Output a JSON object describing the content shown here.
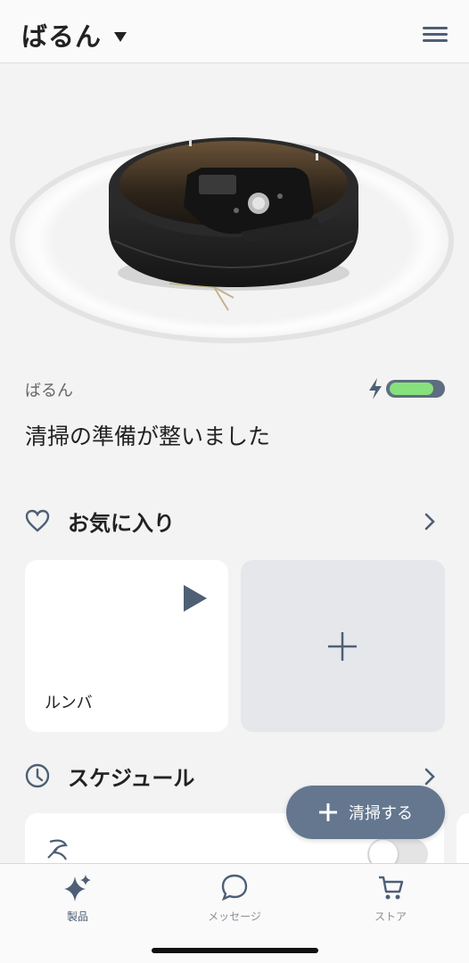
{
  "header": {
    "title": "ばるん",
    "dropdown_icon": "caret-down-icon",
    "menu_icon": "hamburger-menu-icon"
  },
  "device": {
    "name": "ばるん",
    "status": "清掃の準備が整いました",
    "charging_icon": "lightning-bolt-icon",
    "battery_level": 0.85,
    "battery_color": "#86e07c"
  },
  "favorites": {
    "label": "お気に入り",
    "icon": "heart-icon",
    "items": [
      {
        "name": "ルンバ",
        "action_icon": "play-icon"
      }
    ],
    "add_icon": "plus-icon"
  },
  "schedule": {
    "label": "スケジュール",
    "icon": "clock-icon",
    "toggle_on": false
  },
  "fab": {
    "label": "清掃する",
    "icon": "plus-icon"
  },
  "tabs": [
    {
      "label": "製品",
      "icon": "sparkle-icon",
      "active": true
    },
    {
      "label": "メッセージ",
      "icon": "chat-bubble-icon",
      "active": false
    },
    {
      "label": "ストア",
      "icon": "cart-icon",
      "active": false
    }
  ],
  "colors": {
    "accent": "#4e5f76",
    "fab": "#64778f",
    "background": "#f3f3f3"
  }
}
